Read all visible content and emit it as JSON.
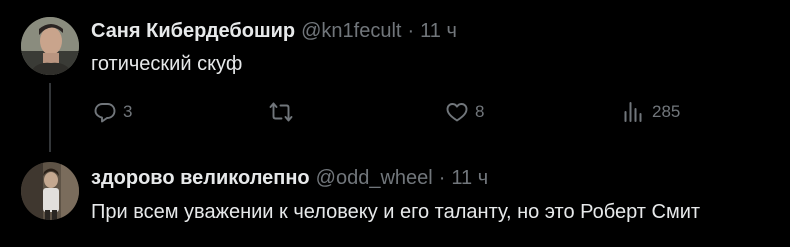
{
  "tweets": [
    {
      "author": {
        "display_name": "Саня Кибердебошир",
        "handle": "@kn1fecult",
        "separator": "·",
        "time": "11 ч"
      },
      "text": "готический скуф",
      "actions": {
        "replies": "3",
        "retweets": "",
        "likes": "8",
        "views": "285"
      }
    },
    {
      "author": {
        "display_name": "здорово великолепно",
        "handle": "@odd_wheel",
        "separator": "·",
        "time": "11 ч"
      },
      "text": "При всем уважении к человеку и его таланту, но это Роберт Смит"
    }
  ],
  "colors": {
    "background": "#000000",
    "primary_text": "#e7e9ea",
    "secondary_text": "#71767b",
    "thread_line": "#333639"
  },
  "icons": {
    "reply": "reply-icon",
    "retweet": "retweet-icon",
    "like": "heart-icon",
    "views": "views-icon"
  }
}
